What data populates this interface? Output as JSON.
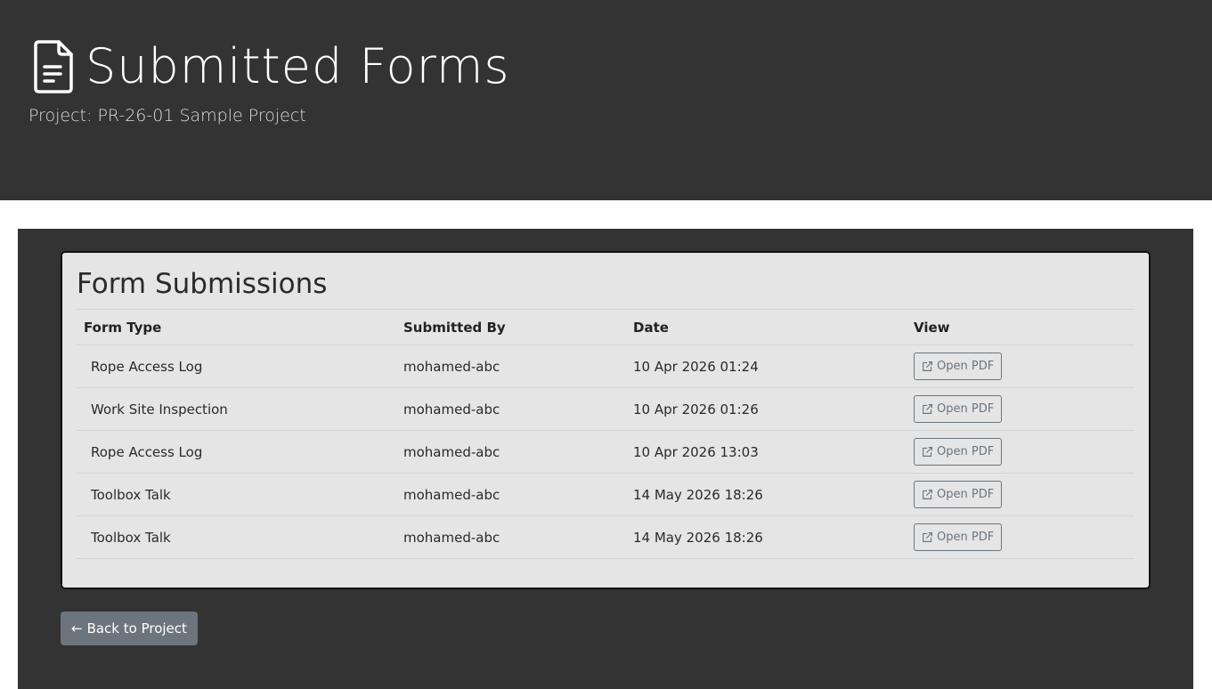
{
  "header": {
    "title": "Submitted Forms",
    "subtitle": "Project: PR-26-01 Sample Project",
    "title_icon": "file-text-icon"
  },
  "card": {
    "title": "Form Submissions"
  },
  "table": {
    "columns": [
      "Form Type",
      "Submitted By",
      "Date",
      "View"
    ],
    "rows": [
      {
        "form_type": "Rope Access Log",
        "submitted_by": "mohamed-abc",
        "date": "10 Apr 2026 01:24",
        "view_label": "Open PDF"
      },
      {
        "form_type": "Work Site Inspection",
        "submitted_by": "mohamed-abc",
        "date": "10 Apr 2026 01:26",
        "view_label": "Open PDF"
      },
      {
        "form_type": "Rope Access Log",
        "submitted_by": "mohamed-abc",
        "date": "10 Apr 2026 13:03",
        "view_label": "Open PDF"
      },
      {
        "form_type": "Toolbox Talk",
        "submitted_by": "mohamed-abc",
        "date": "14 May 2026 18:26",
        "view_label": "Open PDF"
      },
      {
        "form_type": "Toolbox Talk",
        "submitted_by": "mohamed-abc",
        "date": "14 May 2026 18:26",
        "view_label": "Open PDF"
      }
    ]
  },
  "actions": {
    "back_arrow": "←",
    "back_label": "Back to Project",
    "open_pdf_icon": "external-link-icon"
  },
  "colors": {
    "header_bg": "#333333",
    "card_bg": "#e5e5e5",
    "secondary": "#6c757d"
  }
}
